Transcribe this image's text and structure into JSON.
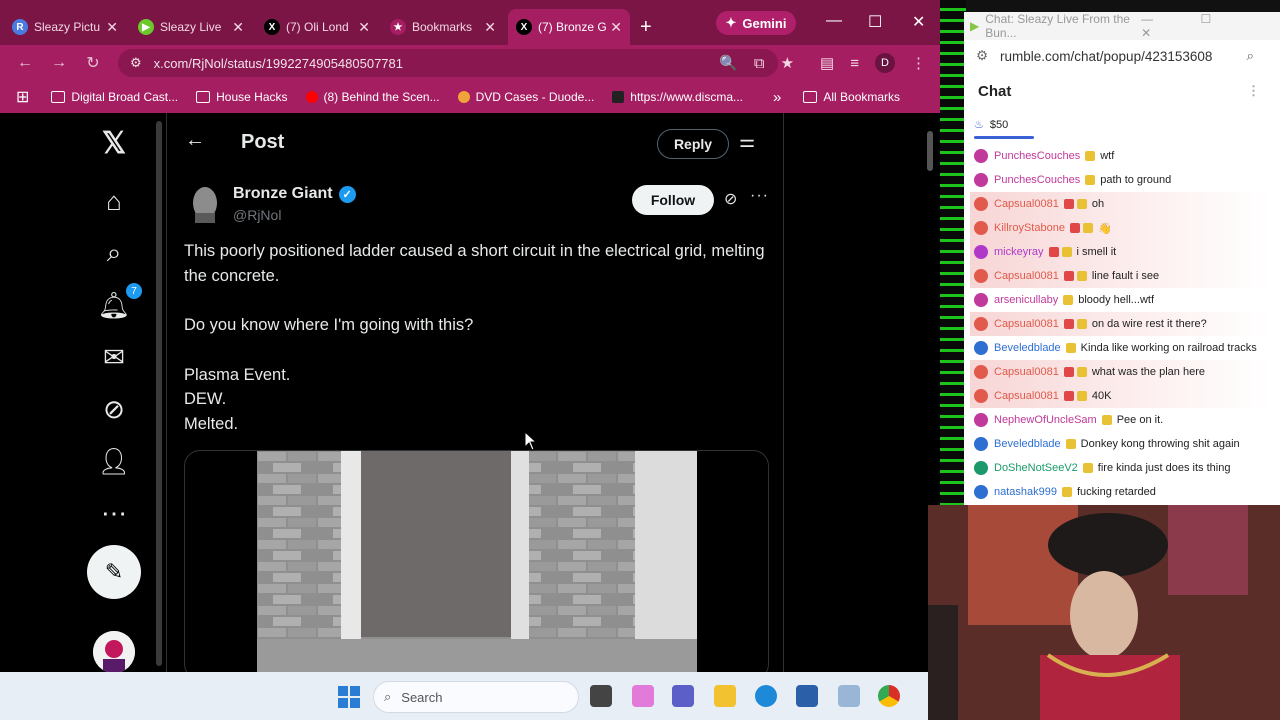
{
  "browser": {
    "tabs": [
      {
        "title": "Sleazy Pictu",
        "icon_color": "#4a7be0",
        "icon_letter": "R"
      },
      {
        "title": "Sleazy Live",
        "icon_color": "#6ac82a",
        "icon_letter": "▶"
      },
      {
        "title": "(7) Oli Lond",
        "icon_color": "#000000",
        "icon_letter": "X"
      },
      {
        "title": "Bookmarks",
        "icon_color": "#a51e62",
        "icon_letter": "★"
      },
      {
        "title": "(7) Bronze G",
        "icon_color": "#000000",
        "icon_letter": "X"
      }
    ],
    "gemini_label": "Gemini",
    "url": "x.com/RjNol/status/1992274905480507781",
    "profile_letter": "D",
    "bookmarks": [
      "Digital Broad Cast...",
      "House Hacks",
      "(8) Behind the Scen...",
      "DVD Cases - Duode...",
      "https://www.discma...",
      "All Bookmarks"
    ]
  },
  "xpage": {
    "notifications_count": "7",
    "header_title": "Post",
    "reply_label": "Reply",
    "author_name": "Bronze Giant",
    "author_handle": "@RjNol",
    "follow_label": "Follow",
    "post_paragraph_1": "This poorly positioned ladder caused a short circuit in the electrical grid, melting the concrete.",
    "post_paragraph_2": "Do you know where I'm going with this?",
    "post_lines": [
      "Plasma Event.",
      "DEW.",
      "Melted."
    ]
  },
  "taskbar": {
    "search_placeholder": "Search"
  },
  "chat": {
    "window_title": "Chat: Sleazy Live From the Bun...",
    "url": "rumble.com/chat/popup/423153608",
    "heading": "Chat",
    "tip_amount": "$50",
    "messages": [
      {
        "user": "PunchesCouches",
        "text": "wtf",
        "color": "#c0399b",
        "highlight": false
      },
      {
        "user": "PunchesCouches",
        "text": "path to ground",
        "color": "#c0399b",
        "highlight": false
      },
      {
        "user": "Capsual0081",
        "text": "oh",
        "color": "#e05b4b",
        "highlight": true
      },
      {
        "user": "KillroyStabone",
        "text": "👋",
        "color": "#e05b4b",
        "highlight": true
      },
      {
        "user": "mickeyray",
        "text": "i smell it",
        "color": "#b03ac8",
        "highlight": true
      },
      {
        "user": "Capsual0081",
        "text": "line fault i see",
        "color": "#e05b4b",
        "highlight": true
      },
      {
        "user": "arsenicullaby",
        "text": "bloody hell...wtf",
        "color": "#c0399b",
        "highlight": false
      },
      {
        "user": "Capsual0081",
        "text": "on da wire rest it there?",
        "color": "#e05b4b",
        "highlight": true
      },
      {
        "user": "Beveledblade",
        "text": "Kinda like working on railroad tracks",
        "color": "#2f6fd1",
        "highlight": false
      },
      {
        "user": "Capsual0081",
        "text": "what was the plan here",
        "color": "#e05b4b",
        "highlight": true
      },
      {
        "user": "Capsual0081",
        "text": "40K",
        "color": "#e05b4b",
        "highlight": true
      },
      {
        "user": "NephewOfUncleSam",
        "text": "Pee on it.",
        "color": "#c0399b",
        "highlight": false
      },
      {
        "user": "Beveledblade",
        "text": "Donkey kong throwing shit again",
        "color": "#2f6fd1",
        "highlight": false
      },
      {
        "user": "DoSheNotSeeV2",
        "text": "fire kinda just does its thing",
        "color": "#1a9a6a",
        "highlight": false
      },
      {
        "user": "natashak999",
        "text": "fucking retarded",
        "color": "#2f6fd1",
        "highlight": false
      }
    ]
  }
}
